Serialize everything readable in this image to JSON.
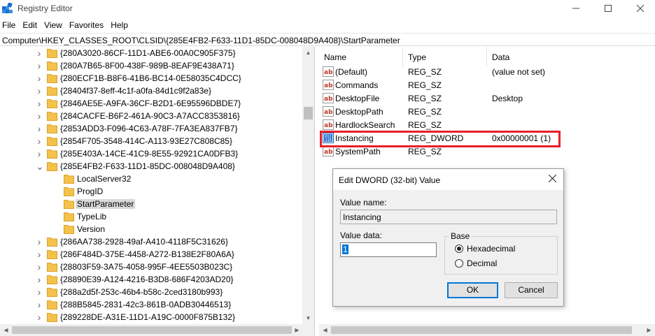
{
  "window": {
    "title": "Registry Editor"
  },
  "menu": [
    "File",
    "Edit",
    "View",
    "Favorites",
    "Help"
  ],
  "address": "Computer\\HKEY_CLASSES_ROOT\\CLSID\\{285E4FB2-F633-11D1-85DC-008048D9A408}\\StartParameter",
  "tree": [
    {
      "label": "{280A3020-86CF-11D1-ABE6-00A0C905F375}",
      "level": 1,
      "expander": "collapsed"
    },
    {
      "label": "{280A7B65-8F00-438F-989B-8EAF9E438A71}",
      "level": 1,
      "expander": "collapsed"
    },
    {
      "label": "{280ECF1B-B8F6-41B6-BC14-0E58035C4DCC}",
      "level": 1,
      "expander": "collapsed"
    },
    {
      "label": "{28404f37-8eff-4c1f-a0fa-84d1c9f2a83e}",
      "level": 1,
      "expander": "collapsed"
    },
    {
      "label": "{2846AE5E-A9FA-36CF-B2D1-6E95596DBDE7}",
      "level": 1,
      "expander": "collapsed"
    },
    {
      "label": "{284CACFE-B6F2-461A-90C3-A7ACC8353816}",
      "level": 1,
      "expander": "collapsed"
    },
    {
      "label": "{2853ADD3-F096-4C63-A78F-7FA3EA837FB7}",
      "level": 1,
      "expander": "collapsed"
    },
    {
      "label": "{2854F705-3548-414C-A113-93E27C808C85}",
      "level": 1,
      "expander": "collapsed"
    },
    {
      "label": "{285E403A-14CE-41C9-8E55-92921CA0DFB3}",
      "level": 1,
      "expander": "collapsed"
    },
    {
      "label": "{285E4FB2-F633-11D1-85DC-008048D9A408}",
      "level": 1,
      "expander": "expanded"
    },
    {
      "label": "LocalServer32",
      "level": 2,
      "expander": "none"
    },
    {
      "label": "ProgID",
      "level": 2,
      "expander": "none"
    },
    {
      "label": "StartParameter",
      "level": 2,
      "expander": "none",
      "selected": true
    },
    {
      "label": "TypeLib",
      "level": 2,
      "expander": "none"
    },
    {
      "label": "Version",
      "level": 2,
      "expander": "none"
    },
    {
      "label": "{286AA738-2928-49af-A410-4118F5C31626}",
      "level": 1,
      "expander": "collapsed"
    },
    {
      "label": "{286F484D-375E-4458-A272-B138E2F80A6A}",
      "level": 1,
      "expander": "collapsed"
    },
    {
      "label": "{28803F59-3A75-4058-995F-4EE5503B023C}",
      "level": 1,
      "expander": "collapsed"
    },
    {
      "label": "{28890E39-A124-4216-B3D8-686F4203AD20}",
      "level": 1,
      "expander": "collapsed"
    },
    {
      "label": "{288a2d5f-253c-46b4-b58c-2ced3180b993}",
      "level": 1,
      "expander": "collapsed"
    },
    {
      "label": "{288B5845-2831-42c3-861B-0ADB30446513}",
      "level": 1,
      "expander": "collapsed"
    },
    {
      "label": "{289228DE-A31E-11D1-A19C-0000F875B132}",
      "level": 1,
      "expander": "collapsed"
    }
  ],
  "columns": {
    "name": "Name",
    "type": "Type",
    "data": "Data"
  },
  "values": [
    {
      "name": "(Default)",
      "type": "REG_SZ",
      "data": "(value not set)",
      "icon": "string-value-icon"
    },
    {
      "name": "Commands",
      "type": "REG_SZ",
      "data": "",
      "icon": "string-value-icon"
    },
    {
      "name": "DesktopFile",
      "type": "REG_SZ",
      "data": "Desktop",
      "icon": "string-value-icon"
    },
    {
      "name": "DesktopPath",
      "type": "REG_SZ",
      "data": "",
      "icon": "string-value-icon"
    },
    {
      "name": "HardlockSearch",
      "type": "REG_SZ",
      "data": "",
      "icon": "string-value-icon"
    },
    {
      "name": "Instancing",
      "type": "REG_DWORD",
      "data": "0x00000001 (1)",
      "icon": "dword-value-icon"
    },
    {
      "name": "SystemPath",
      "type": "REG_SZ",
      "data": "",
      "icon": "string-value-icon"
    }
  ],
  "dialog": {
    "title": "Edit DWORD (32-bit) Value",
    "value_name_label": "Value name:",
    "value_name": "Instancing",
    "value_data_label": "Value data:",
    "value_data": "1",
    "base_label": "Base",
    "hex_label": "Hexadecimal",
    "dec_label": "Decimal",
    "ok_label": "OK",
    "cancel_label": "Cancel",
    "selected_base": "Hexadecimal"
  },
  "colors": {
    "highlight_box": "#e8202a",
    "folder": "#f4c24a",
    "accent": "#0078d7"
  }
}
